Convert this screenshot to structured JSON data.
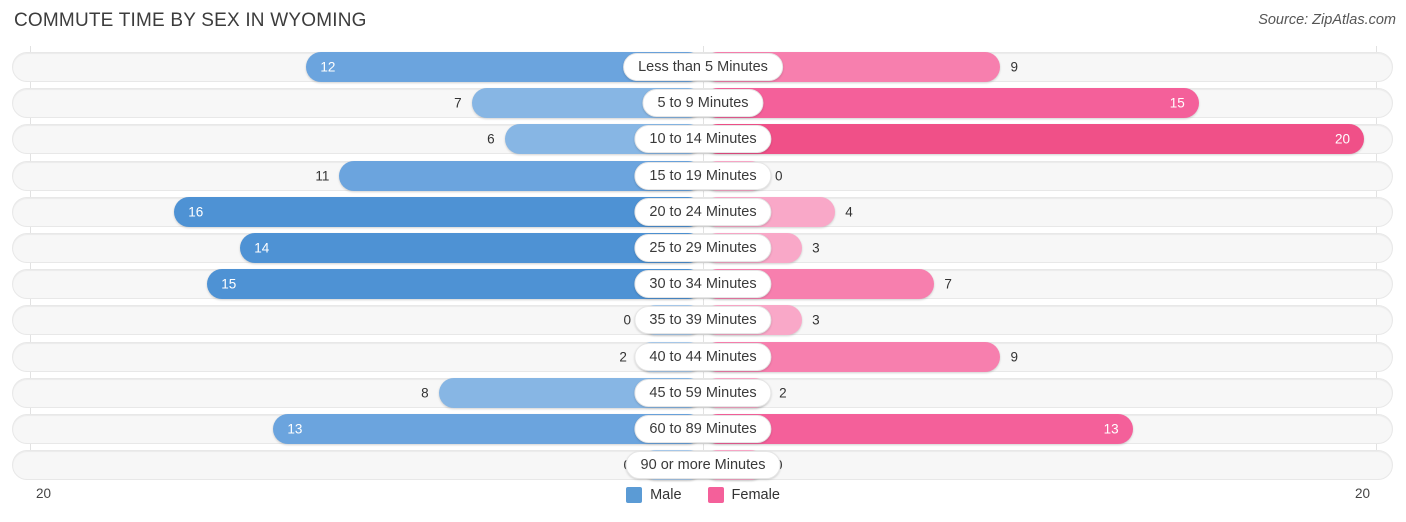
{
  "header": {
    "title": "COMMUTE TIME BY SEX IN WYOMING",
    "source": "Source: ZipAtlas.com"
  },
  "axis": {
    "left_end": "20",
    "right_end": "20"
  },
  "legend": {
    "items": [
      {
        "label": "Male",
        "color": "#5B9BD5"
      },
      {
        "label": "Female",
        "color": "#F4609A"
      }
    ]
  },
  "chart_data": {
    "type": "bar",
    "title": "COMMUTE TIME BY SEX IN WYOMING",
    "orientation": "horizontal-diverging",
    "xlabel": "",
    "ylabel": "",
    "xlim": [
      -20,
      20
    ],
    "grid": true,
    "legend_position": "bottom-center",
    "categories": [
      "Less than 5 Minutes",
      "5 to 9 Minutes",
      "10 to 14 Minutes",
      "15 to 19 Minutes",
      "20 to 24 Minutes",
      "25 to 29 Minutes",
      "30 to 34 Minutes",
      "35 to 39 Minutes",
      "40 to 44 Minutes",
      "45 to 59 Minutes",
      "60 to 89 Minutes",
      "90 or more Minutes"
    ],
    "series": [
      {
        "name": "Male",
        "side": "left",
        "values": [
          12,
          7,
          6,
          11,
          16,
          14,
          15,
          0,
          2,
          8,
          13,
          0
        ]
      },
      {
        "name": "Female",
        "side": "right",
        "values": [
          9,
          15,
          20,
          0,
          4,
          3,
          7,
          3,
          9,
          2,
          13,
          0
        ]
      }
    ]
  },
  "rows": [
    {
      "category": "Less than 5 Minutes",
      "male": "12",
      "female": "9"
    },
    {
      "category": "5 to 9 Minutes",
      "male": "7",
      "female": "15"
    },
    {
      "category": "10 to 14 Minutes",
      "male": "6",
      "female": "20"
    },
    {
      "category": "15 to 19 Minutes",
      "male": "11",
      "female": "0"
    },
    {
      "category": "20 to 24 Minutes",
      "male": "16",
      "female": "4"
    },
    {
      "category": "25 to 29 Minutes",
      "male": "14",
      "female": "3"
    },
    {
      "category": "30 to 34 Minutes",
      "male": "15",
      "female": "7"
    },
    {
      "category": "35 to 39 Minutes",
      "male": "0",
      "female": "3"
    },
    {
      "category": "40 to 44 Minutes",
      "male": "2",
      "female": "9"
    },
    {
      "category": "45 to 59 Minutes",
      "male": "8",
      "female": "2"
    },
    {
      "category": "60 to 89 Minutes",
      "male": "13",
      "female": "13"
    },
    {
      "category": "90 or more Minutes",
      "male": "0",
      "female": "0"
    }
  ]
}
